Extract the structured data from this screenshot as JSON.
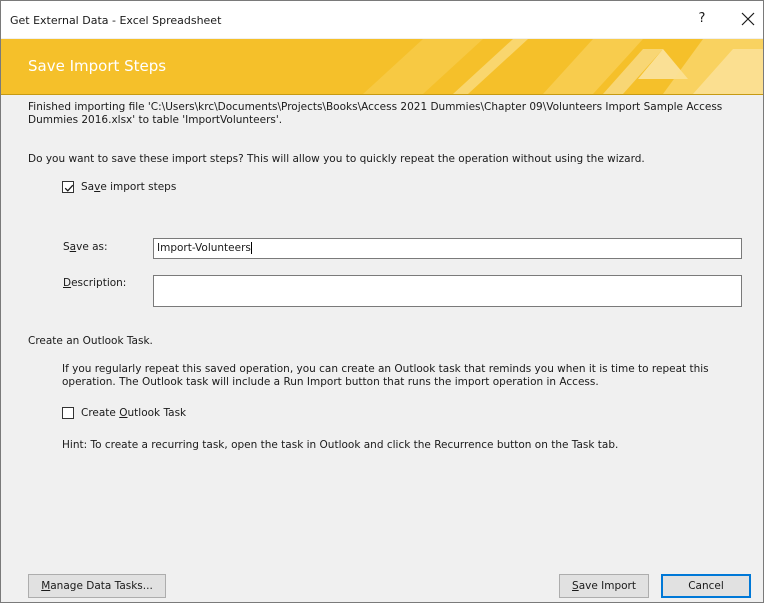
{
  "window": {
    "title": "Get External Data - Excel Spreadsheet",
    "help_label": "?",
    "close_icon": "close-icon"
  },
  "banner": {
    "title": "Save Import Steps",
    "color": "#f5c02a"
  },
  "content": {
    "finished_line1": "Finished importing file 'C:\\Users\\krc\\Documents\\Projects\\Books\\Access 2021 Dummies\\Chapter 09\\Volunteers Import Sample Access",
    "finished_line2": "Dummies 2016.xlsx' to table 'ImportVolunteers'.",
    "question": "Do you want to save these import steps? This will allow you to quickly repeat the operation without using the wizard.",
    "save_steps": {
      "label_pre": "Sa",
      "label_accel": "v",
      "label_post": "e import steps",
      "checked": true
    },
    "save_as": {
      "label_pre": "S",
      "label_accel": "a",
      "label_post": "ve as:",
      "value": "Import-Volunteers"
    },
    "description": {
      "label_accel": "D",
      "label_post": "escription:",
      "value": ""
    },
    "outlook_heading": "Create an Outlook Task.",
    "outlook_text_line1": "If you regularly repeat this saved operation, you can create an Outlook task that reminds you when it is time to repeat this",
    "outlook_text_line2": "operation. The Outlook task will include a Run Import button that runs the import operation in Access.",
    "create_task": {
      "label_pre": "Create ",
      "label_accel": "O",
      "label_post": "utlook Task",
      "checked": false
    },
    "hint": "Hint: To create a recurring task, open the task in Outlook and click the Recurrence button on the Task tab."
  },
  "footer": {
    "manage_pre": "",
    "manage_accel": "M",
    "manage_post": "anage Data Tasks...",
    "save_import_accel": "S",
    "save_import_post": "ave Import",
    "cancel": "Cancel"
  }
}
